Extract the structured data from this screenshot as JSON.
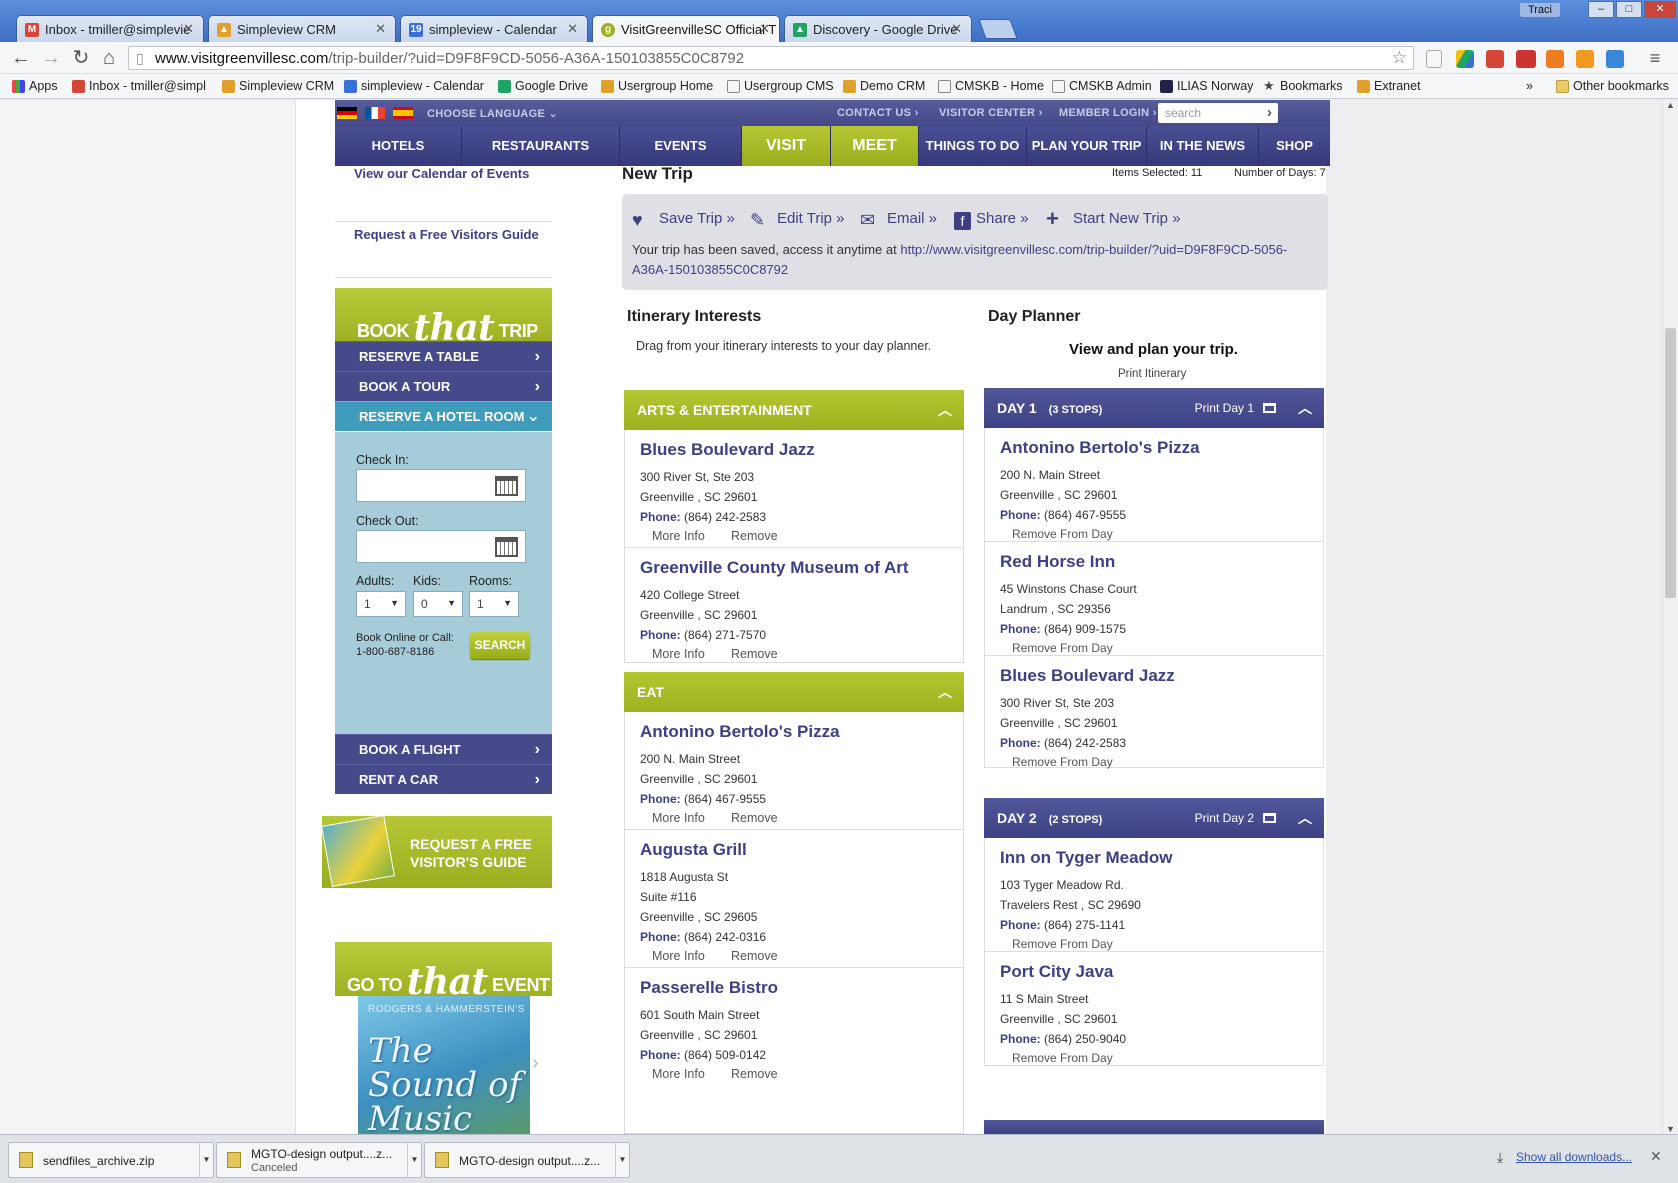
{
  "browser": {
    "tabs": [
      {
        "label": "Inbox - tmiller@simplevie",
        "icon": "gmail-icon",
        "color": "#d44638"
      },
      {
        "label": "Simpleview CRM",
        "icon": "crm-icon",
        "color": "#e0a12b"
      },
      {
        "label": "simpleview - Calendar",
        "icon": "calendar-icon",
        "color": "#3a6fd8"
      },
      {
        "label": "VisitGreenvilleSC Official T",
        "icon": "greenville-icon",
        "color": "#9fb123"
      },
      {
        "label": "Discovery - Google Drive",
        "icon": "drive-icon",
        "color": "#1fa463"
      }
    ],
    "user": "Traci",
    "url_domain": "www.visitgreenvillesc.com",
    "url_path": "/trip-builder/?uid=D9F8F9CD-5056-A36A-150103855C0C8792",
    "bookmarks": [
      "Apps",
      "Inbox - tmiller@simpl",
      "Simpleview CRM",
      "simpleview - Calendar",
      "Google Drive",
      "Usergroup Home",
      "Usergroup CMS",
      "Demo CRM",
      "CMSKB - Home",
      "CMSKB Admin",
      "ILIAS Norway",
      "Bookmarks",
      "Extranet"
    ],
    "other_bookmarks": "Other bookmarks",
    "more_bookmarks": "»"
  },
  "header": {
    "choose_language": "CHOOSE LANGUAGE",
    "contact_us": "CONTACT US",
    "visitor_center": "VISITOR CENTER",
    "member_login": "MEMBER LOGIN",
    "search_placeholder": "search"
  },
  "mainnav": [
    "HOTELS",
    "RESTAURANTS",
    "EVENTS",
    "VISIT",
    "MEET",
    "THINGS TO DO",
    "PLAN YOUR TRIP",
    "IN THE NEWS",
    "SHOP"
  ],
  "sidebar": {
    "calendar_link": "View our Calendar of Events",
    "visitors_guide_link": "Request a Free Visitors Guide",
    "book_pre": "BOOK",
    "book_that": "that",
    "book_post": "TRIP",
    "items_top": [
      "RESERVE A TABLE",
      "BOOK A TOUR",
      "RESERVE A HOTEL ROOM"
    ],
    "hotel": {
      "check_in": "Check In:",
      "check_out": "Check Out:",
      "adults_label": "Adults:",
      "kids_label": "Kids:",
      "rooms_label": "Rooms:",
      "adults": "1",
      "kids": "0",
      "rooms": "1",
      "book_online": "Book Online or Call:",
      "phone": "1-800-687-8186",
      "search": "SEARCH"
    },
    "items_bottom": [
      "BOOK A FLIGHT",
      "RENT A CAR"
    ],
    "guide_line1": "REQUEST A FREE",
    "guide_line2": "VISITOR'S GUIDE",
    "event_pre": "GO TO",
    "event_that": "that",
    "event_post": "EVENT",
    "event_subtitle": "RODGERS & HAMMERSTEIN'S",
    "event_title1": "The",
    "event_title2": "Sound of",
    "event_title3": "Music"
  },
  "trip": {
    "title": "New Trip",
    "items_selected": "Items Selected: 11",
    "number_of_days": "Number of Days: 7",
    "actions": [
      "Save Trip »",
      "Edit Trip »",
      "Email »",
      "Share »",
      "Start New Trip »"
    ],
    "saved_text": "Your trip has been saved, access it anytime at",
    "saved_url": "http://www.visitgreenvillesc.com/trip-builder/?uid=D9F8F9CD-5056-A36A-150103855C0C8792"
  },
  "interests": {
    "title": "Itinerary Interests",
    "hint": "Drag from your itinerary interests to your day planner.",
    "more_info": "More Info",
    "remove": "Remove",
    "phone_label": "Phone:",
    "categories": [
      {
        "name": "ARTS & ENTERTAINMENT",
        "items": [
          {
            "name": "Blues Boulevard Jazz",
            "lines": [
              "300 River St, Ste 203",
              "Greenville , SC 29601"
            ],
            "phone": "(864) 242-2583"
          },
          {
            "name": "Greenville County Museum of Art",
            "lines": [
              "420 College Street",
              "Greenville , SC 29601"
            ],
            "phone": "(864) 271-7570"
          }
        ]
      },
      {
        "name": "EAT",
        "items": [
          {
            "name": "Antonino Bertolo's Pizza",
            "lines": [
              "200 N. Main Street",
              "Greenville , SC 29601"
            ],
            "phone": "(864) 467-9555"
          },
          {
            "name": "Augusta Grill",
            "lines": [
              "1818 Augusta St",
              "Suite #116",
              "Greenville , SC 29605"
            ],
            "phone": "(864) 242-0316"
          },
          {
            "name": "Passerelle Bistro",
            "lines": [
              "601 South Main Street",
              "Greenville , SC 29601"
            ],
            "phone": "(864) 509-0142"
          }
        ]
      }
    ]
  },
  "planner": {
    "title": "Day Planner",
    "subtitle": "View and plan your trip.",
    "print_itinerary": "Print Itinerary",
    "remove_from_day": "Remove From Day",
    "phone_label": "Phone:",
    "days": [
      {
        "label": "DAY 1",
        "stops": "(3 STOPS)",
        "print": "Print Day 1",
        "items": [
          {
            "name": "Antonino Bertolo's Pizza",
            "lines": [
              "200 N. Main Street",
              "Greenville , SC 29601"
            ],
            "phone": "(864) 467-9555"
          },
          {
            "name": "Red Horse Inn",
            "lines": [
              "45 Winstons Chase Court",
              "Landrum , SC 29356"
            ],
            "phone": "(864) 909-1575"
          },
          {
            "name": "Blues Boulevard Jazz",
            "lines": [
              "300 River St, Ste 203",
              "Greenville , SC 29601"
            ],
            "phone": "(864) 242-2583"
          }
        ]
      },
      {
        "label": "DAY 2",
        "stops": "(2 STOPS)",
        "print": "Print Day 2",
        "items": [
          {
            "name": "Inn on Tyger Meadow",
            "lines": [
              "103 Tyger Meadow Rd.",
              "Travelers Rest , SC 29690"
            ],
            "phone": "(864) 275-1141"
          },
          {
            "name": "Port City Java",
            "lines": [
              "11 S Main Street",
              "Greenville , SC 29601"
            ],
            "phone": "(864) 250-9040"
          }
        ]
      }
    ]
  },
  "downloads": {
    "items": [
      {
        "name": "sendfiles_archive.zip",
        "status": ""
      },
      {
        "name": "MGTO-design output....z...",
        "status": "Canceled"
      },
      {
        "name": "MGTO-design output....z...",
        "status": ""
      }
    ],
    "show_all": "Show all downloads..."
  },
  "colors": {
    "brand_purple": "#3d4184",
    "brand_green": "#9fb123",
    "hotel_panel": "#a6ccd9"
  }
}
